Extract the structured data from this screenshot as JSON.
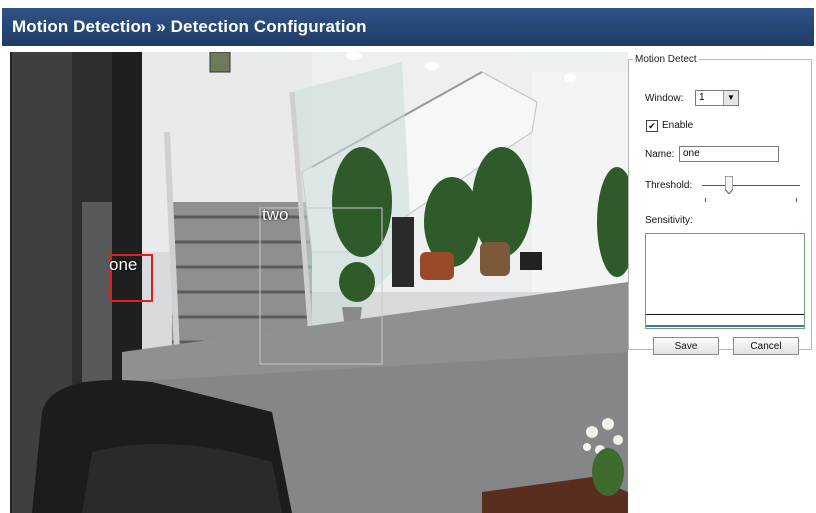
{
  "header": {
    "title": "Motion Detection » Detection Configuration"
  },
  "video": {
    "regions": [
      {
        "label": "one",
        "color": "#e02020"
      },
      {
        "label": "two",
        "color": "#c8c8c8"
      }
    ]
  },
  "panel": {
    "legend": "Motion Detect",
    "window_label": "Window:",
    "window_value": "1",
    "enable_checked": "✔",
    "enable_label": "Enable",
    "name_label": "Name:",
    "name_value": "one",
    "threshold_label": "Threshold:",
    "sensitivity_label": "Sensitivity:",
    "save_label": "Save",
    "cancel_label": "Cancel"
  },
  "colors": {
    "header_bg": "#244673",
    "accent_green": "#6aa56a"
  }
}
